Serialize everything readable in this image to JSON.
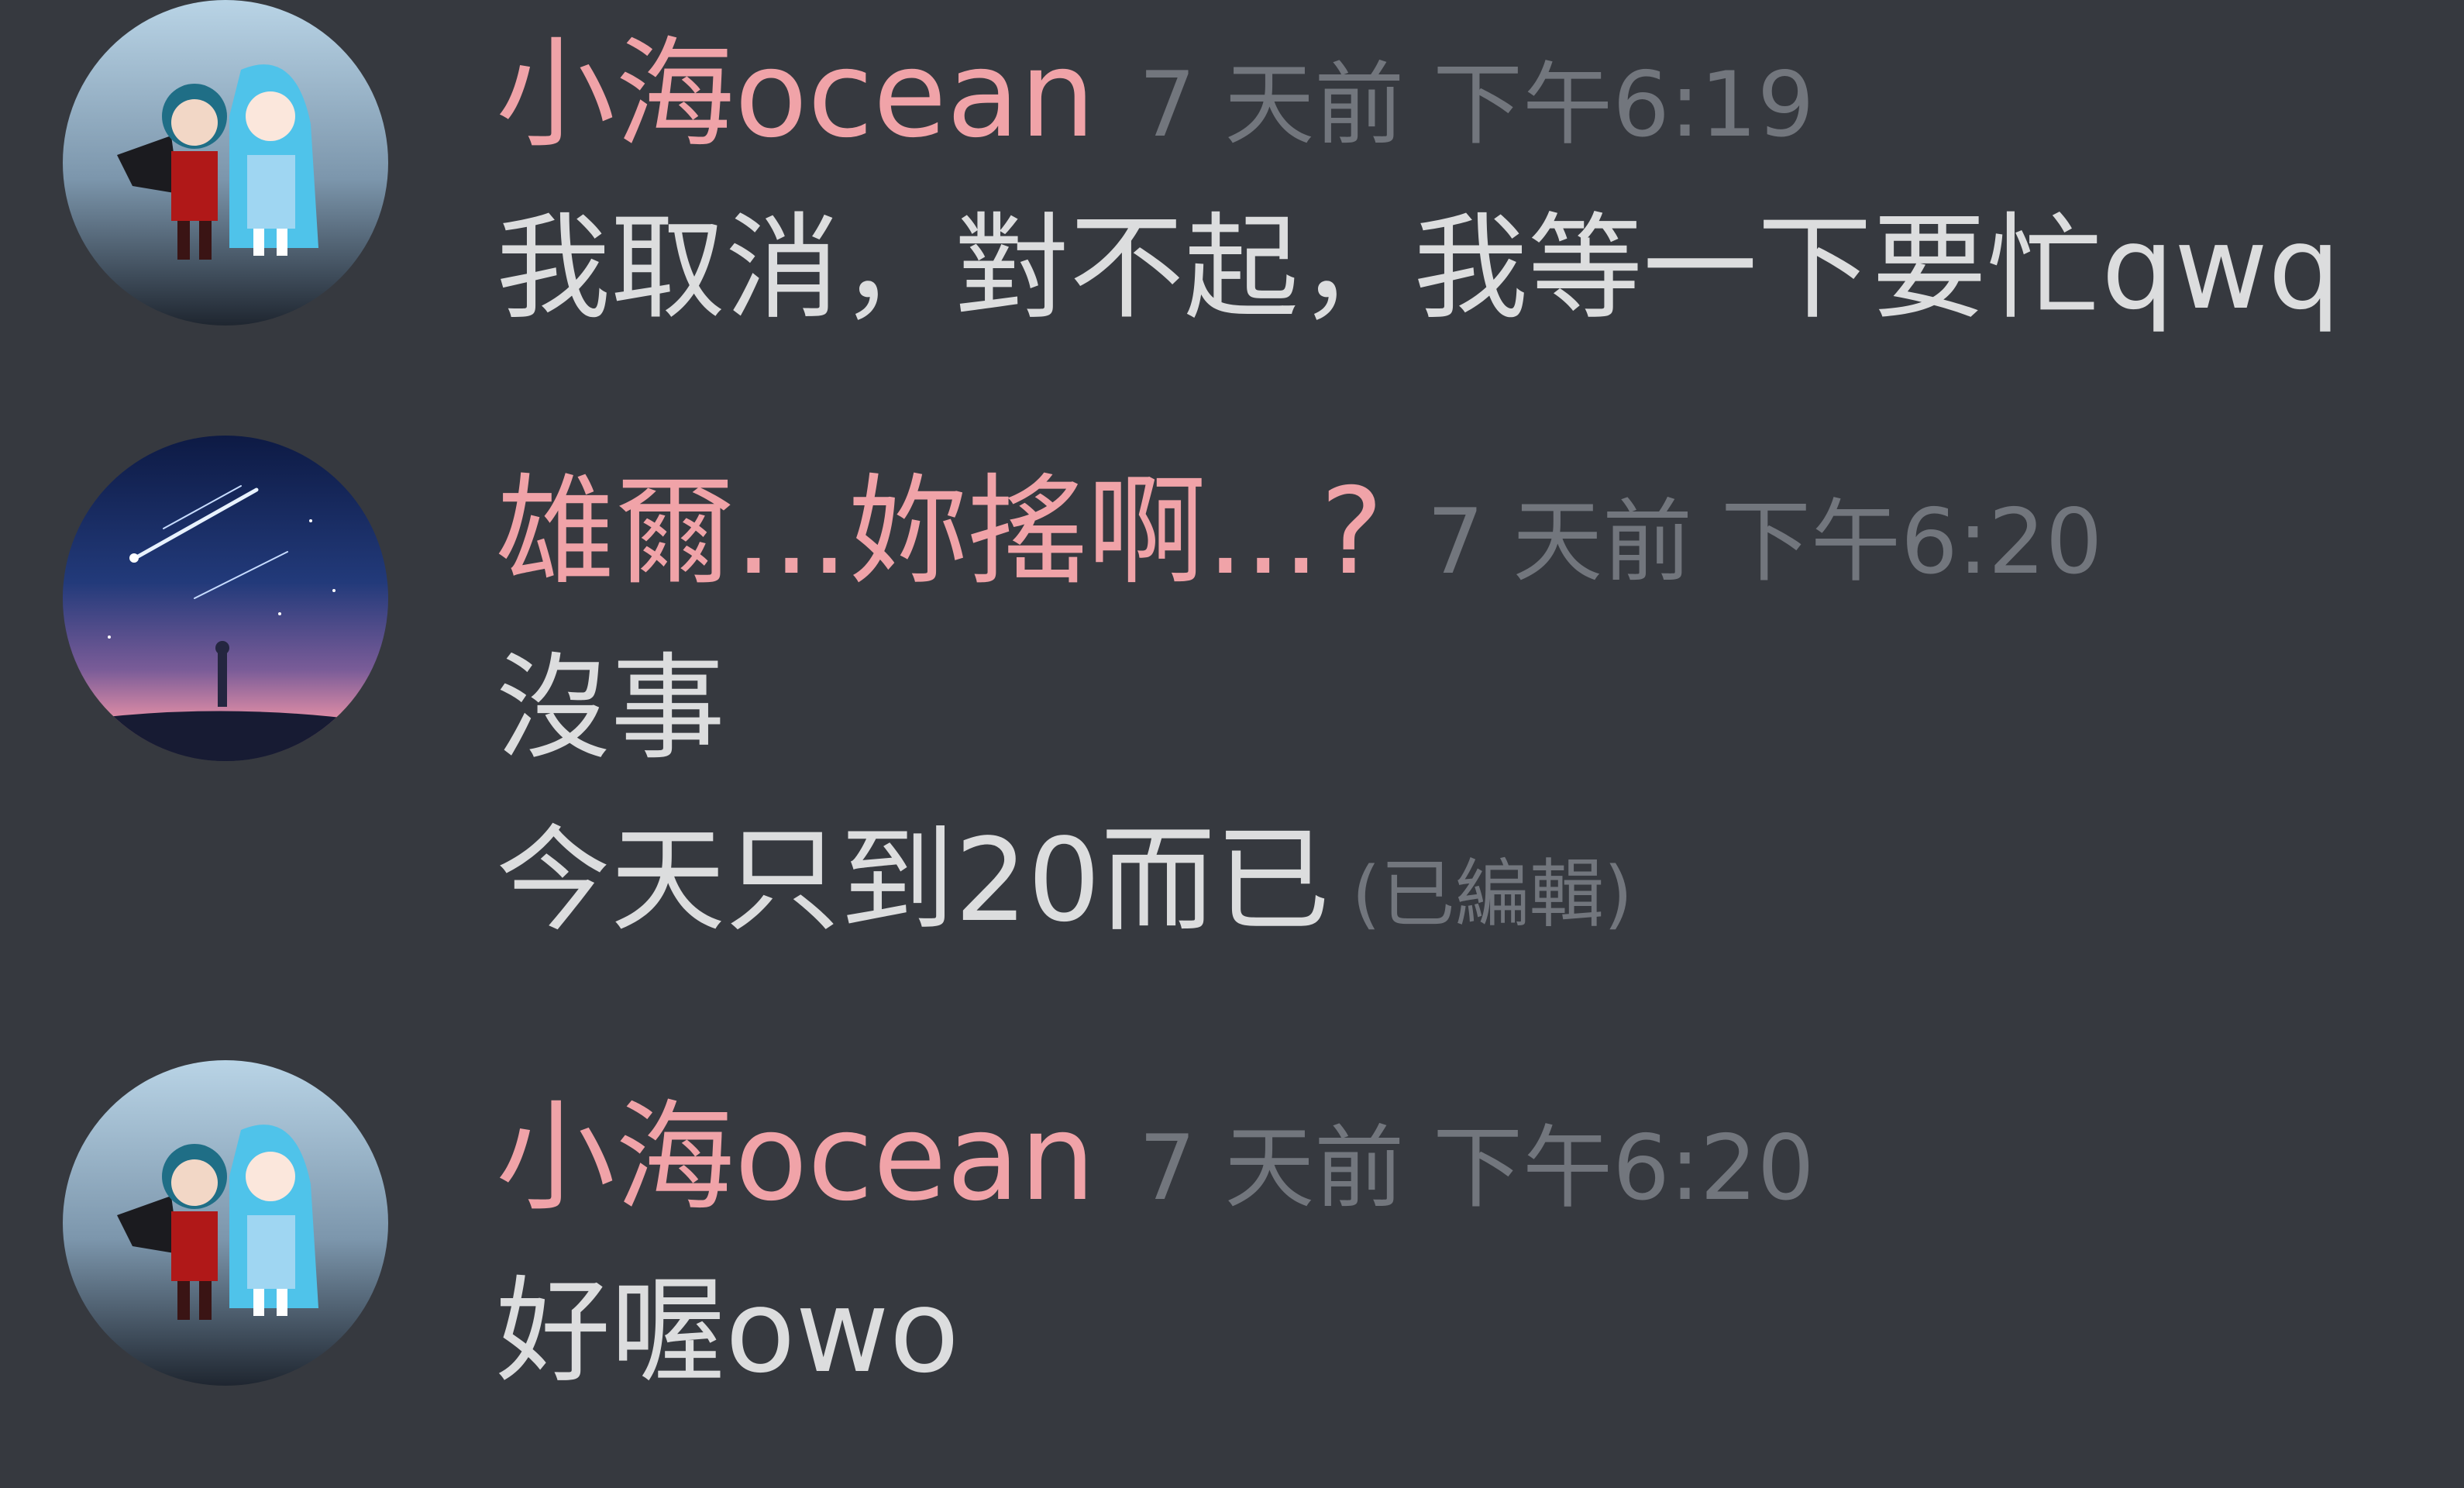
{
  "messages": [
    {
      "author": "小海ocean",
      "avatar_icon": "anime-duo-avatar-icon",
      "timestamp": "7 天前 下午6:19",
      "lines": [
        "我取消，對不起，我等一下要忙qwq"
      ]
    },
    {
      "author": "雄爾...妳搖啊...?",
      "avatar_icon": "starry-sky-avatar-icon",
      "timestamp": "7 天前 下午6:20",
      "lines": [
        "沒事",
        "今天只到20而已"
      ],
      "edited_label": "(已編輯)"
    },
    {
      "author": "小海ocean",
      "avatar_icon": "anime-duo-avatar-icon",
      "timestamp": "7 天前 下午6:20",
      "lines": [
        "好喔owo"
      ]
    }
  ],
  "colors": {
    "background": "#36393f",
    "username": "#f0a3a8",
    "timestamp": "#72767d",
    "message_text": "#dcddde"
  }
}
